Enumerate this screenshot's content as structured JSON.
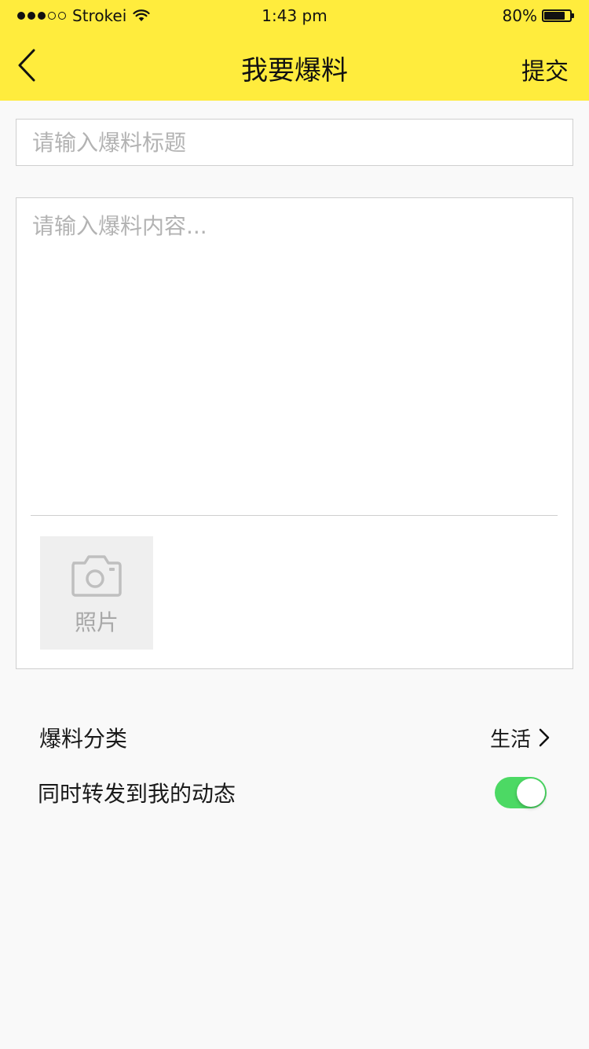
{
  "status_bar": {
    "carrier": "Strokei",
    "time": "1:43 pm",
    "battery_percent": "80%",
    "battery_level": 0.8,
    "signal_bars": 3,
    "signal_total": 5,
    "wifi_icon": "wifi-icon"
  },
  "nav": {
    "title": "我要爆料",
    "submit_label": "提交",
    "back_icon": "chevron-left-icon"
  },
  "form": {
    "title_placeholder": "请输入爆料标题",
    "title_value": "",
    "content_placeholder": "请输入爆料内容...",
    "content_value": "",
    "photo_label": "照片",
    "photo_icon": "camera-icon"
  },
  "settings": {
    "category_label": "爆料分类",
    "category_value": "生活",
    "forward_label": "同时转发到我的动态",
    "forward_enabled": true
  },
  "colors": {
    "header_bg": "#ffec3d",
    "toggle_on": "#4cd964",
    "page_bg": "#f9f9f9"
  }
}
